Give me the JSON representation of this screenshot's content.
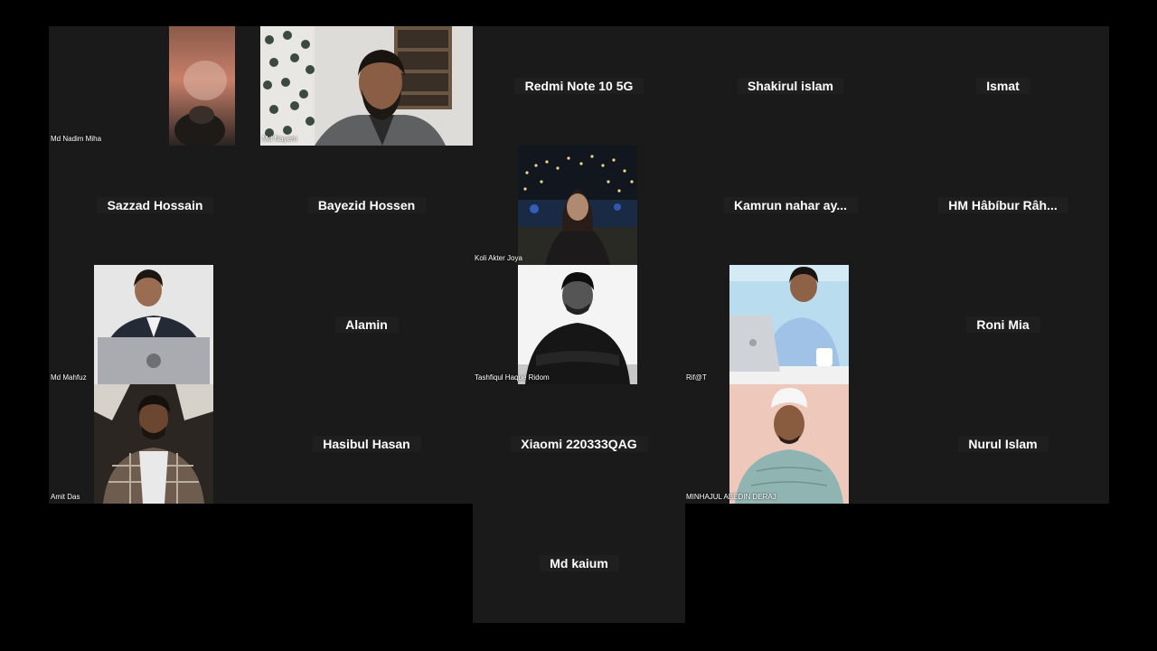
{
  "meeting": {
    "participants": [
      {
        "id": "p01",
        "name": "Md Nadim Miha",
        "has_video": true
      },
      {
        "id": "p02",
        "name": "Md Nayem",
        "has_video": true
      },
      {
        "id": "p03",
        "name": "Redmi Note 10 5G",
        "has_video": false
      },
      {
        "id": "p04",
        "name": "Shakirul islam",
        "has_video": false
      },
      {
        "id": "p05",
        "name": "Ismat",
        "has_video": false
      },
      {
        "id": "p06",
        "name": "Sazzad Hossain",
        "has_video": false
      },
      {
        "id": "p07",
        "name": "Bayezid Hossen",
        "has_video": false
      },
      {
        "id": "p08",
        "name": "Koli Akter Joya",
        "has_video": true
      },
      {
        "id": "p09",
        "name": "Kamrun nahar ay...",
        "has_video": false
      },
      {
        "id": "p10",
        "name": "HM Hâbíbur Râh...",
        "has_video": false
      },
      {
        "id": "p11",
        "name": "Md Mahfuz",
        "has_video": true
      },
      {
        "id": "p12",
        "name": "Alamin",
        "has_video": false
      },
      {
        "id": "p13",
        "name": "Tashfiqul Haque Ridom",
        "has_video": true
      },
      {
        "id": "p14",
        "name": "Rif@T",
        "has_video": true
      },
      {
        "id": "p15",
        "name": "Roni Mia",
        "has_video": false
      },
      {
        "id": "p16",
        "name": "Amit Das",
        "has_video": true
      },
      {
        "id": "p17",
        "name": "Hasibul Hasan",
        "has_video": false
      },
      {
        "id": "p18",
        "name": "Xiaomi 220333QAG",
        "has_video": false
      },
      {
        "id": "p19",
        "name": "MINHAJUL ABEDIN DERAJ",
        "has_video": true
      },
      {
        "id": "p20",
        "name": "Nurul Islam",
        "has_video": false
      },
      {
        "id": "p21",
        "name": "Md kaium",
        "has_video": false
      }
    ]
  },
  "colors": {
    "background": "#000000",
    "tile": "#1a1a1a",
    "name_text": "#ffffff"
  }
}
